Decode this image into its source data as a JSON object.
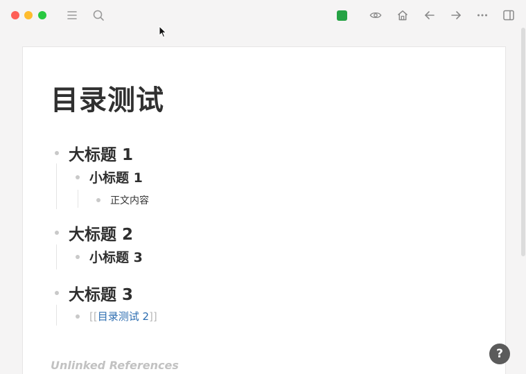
{
  "toolbar": {
    "icons": [
      "menu-icon",
      "search-icon",
      "sync-status-icon",
      "eye-icon",
      "home-icon",
      "arrow-left-icon",
      "arrow-right-icon",
      "more-icon",
      "right-sidebar-icon"
    ],
    "sync_color": "#25a244"
  },
  "page": {
    "title": "目录测试",
    "blocks": {
      "h1_a": "大标题 1",
      "h2_a": "小标题 1",
      "body_a": "正文内容",
      "h1_b": "大标题 2",
      "h2_b": "小标题 3",
      "h1_c": "大标题 3",
      "ref_open": "[[",
      "ref_text": "目录测试 2",
      "ref_close": "]]"
    },
    "unlinked_references": "Unlinked References"
  },
  "help": {
    "label": "?"
  },
  "colors": {
    "link": "#2b6cb0",
    "bullet": "#c9c9c9",
    "help_bg": "#5b5b5b"
  }
}
